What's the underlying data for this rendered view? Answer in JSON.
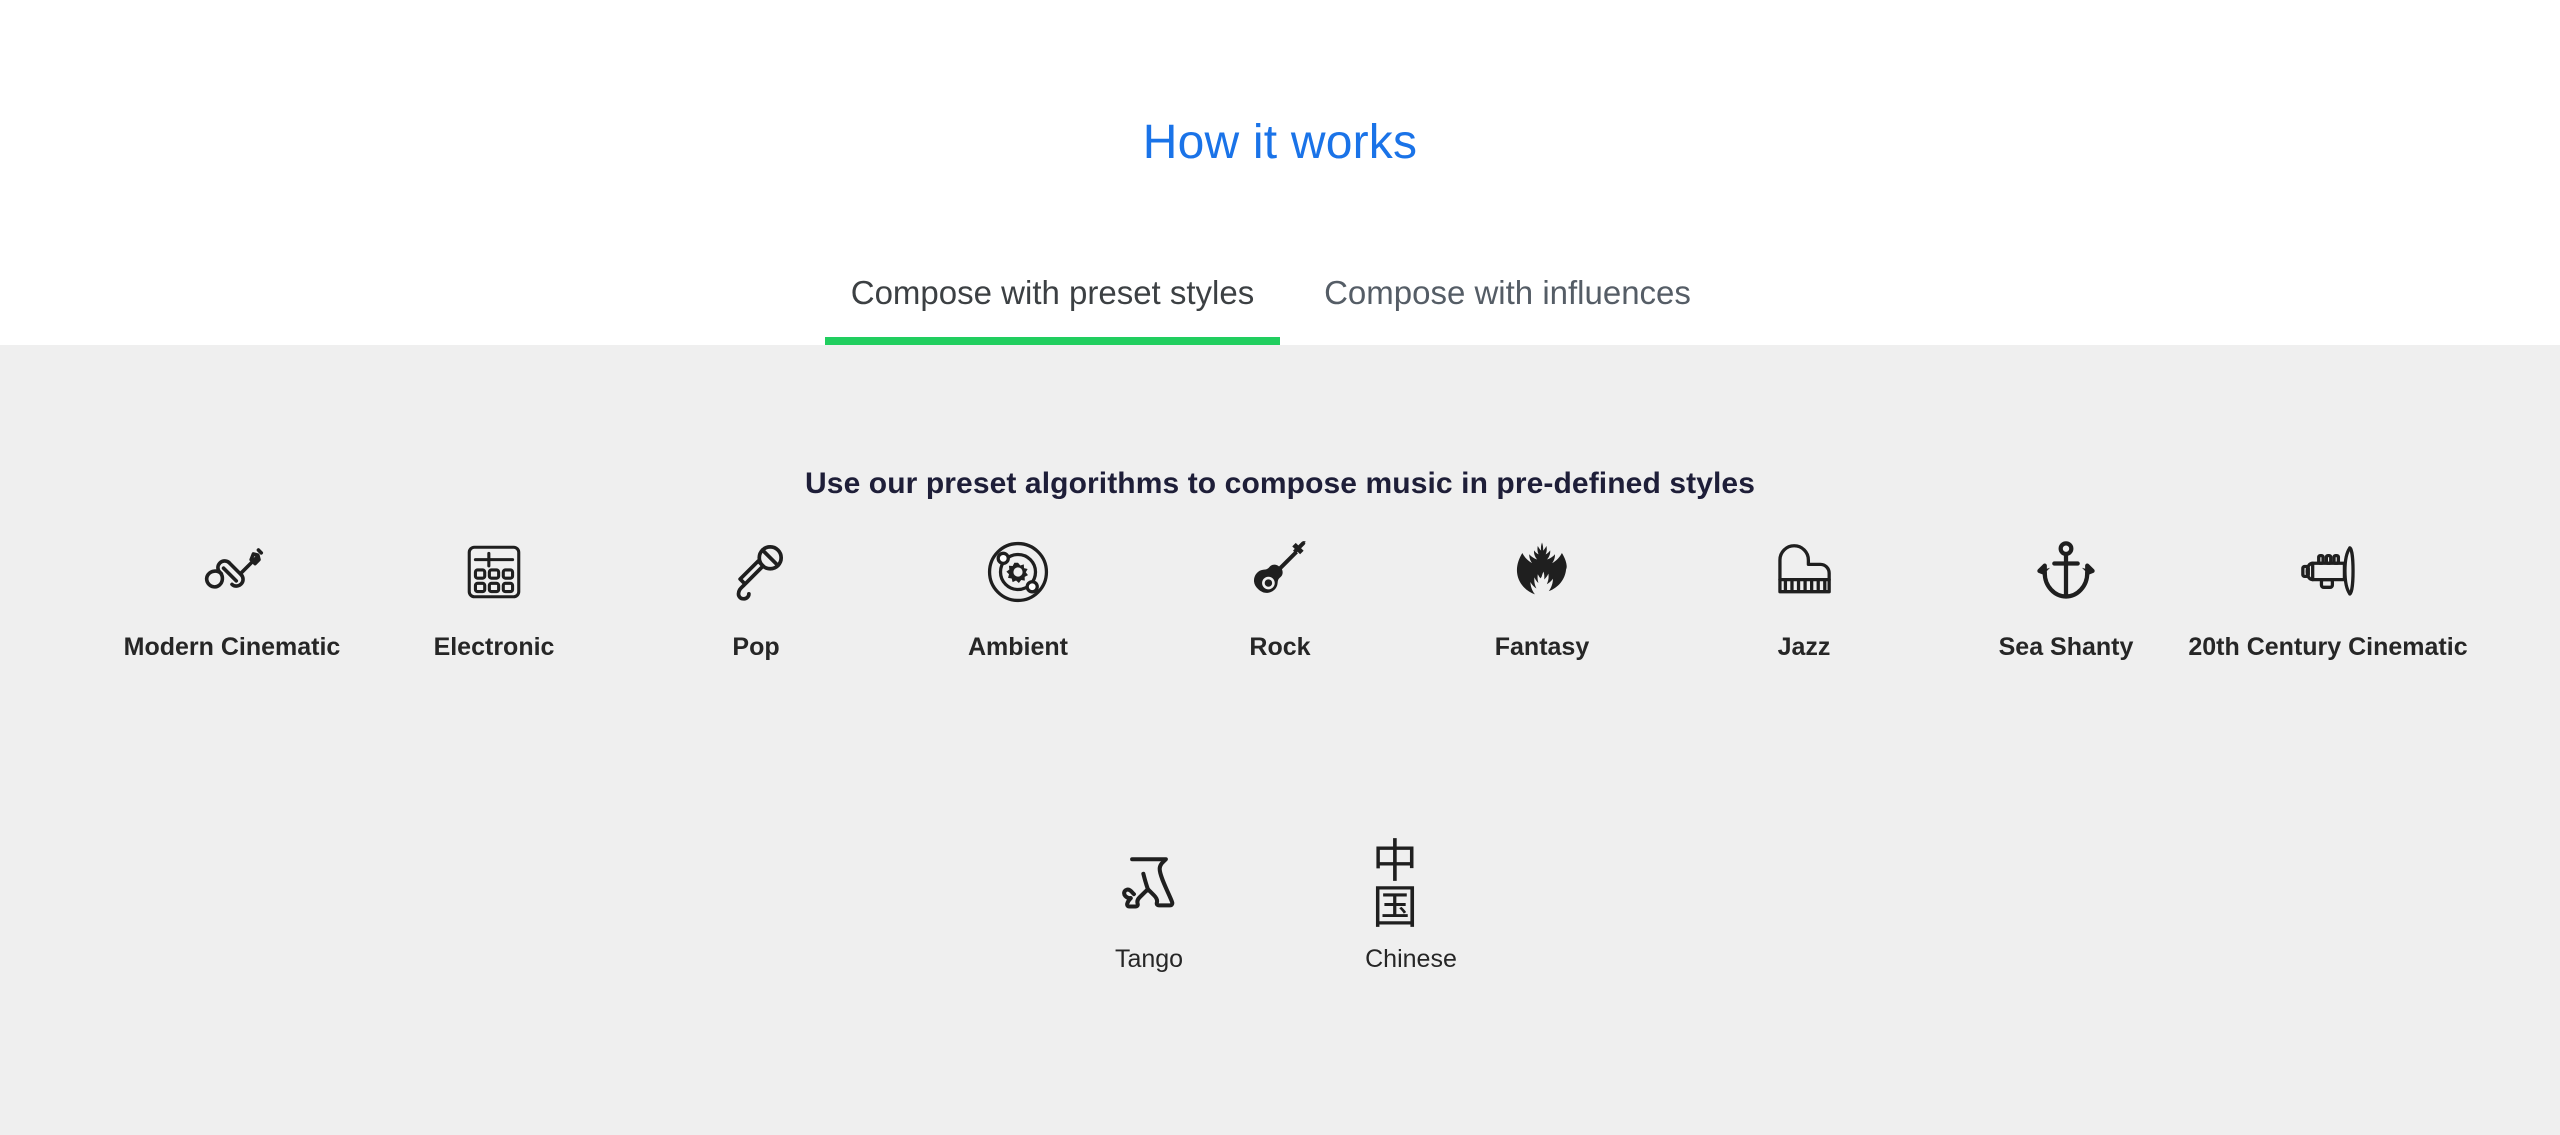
{
  "header": {
    "title": "How it works",
    "title_color": "#1a73e8"
  },
  "tabs": {
    "accent_color": "#21ce5f",
    "active_index": 0,
    "items": [
      {
        "label": "Compose with preset styles",
        "active": true
      },
      {
        "label": "Compose with influences",
        "active": false
      }
    ]
  },
  "main": {
    "subtitle": "Use our preset algorithms to compose music in pre-defined styles",
    "background_color": "#efefef",
    "row1": [
      {
        "label": "Modern Cinematic",
        "icon": "violin-icon"
      },
      {
        "label": "Electronic",
        "icon": "drum-machine-icon"
      },
      {
        "label": "Pop",
        "icon": "microphone-icon"
      },
      {
        "label": "Ambient",
        "icon": "atom-orbit-gear-icon"
      },
      {
        "label": "Rock",
        "icon": "electric-guitar-icon"
      },
      {
        "label": "Fantasy",
        "icon": "dragon-icon"
      },
      {
        "label": "Jazz",
        "icon": "grand-piano-icon"
      },
      {
        "label": "Sea Shanty",
        "icon": "anchor-icon"
      },
      {
        "label": "20th Century Cinematic",
        "icon": "trumpet-icon"
      }
    ],
    "row2": [
      {
        "label": "Tango",
        "icon": "tango-dancers-icon"
      },
      {
        "label": "Chinese",
        "icon": "chinese-characters-icon",
        "glyph": "中国"
      }
    ]
  }
}
